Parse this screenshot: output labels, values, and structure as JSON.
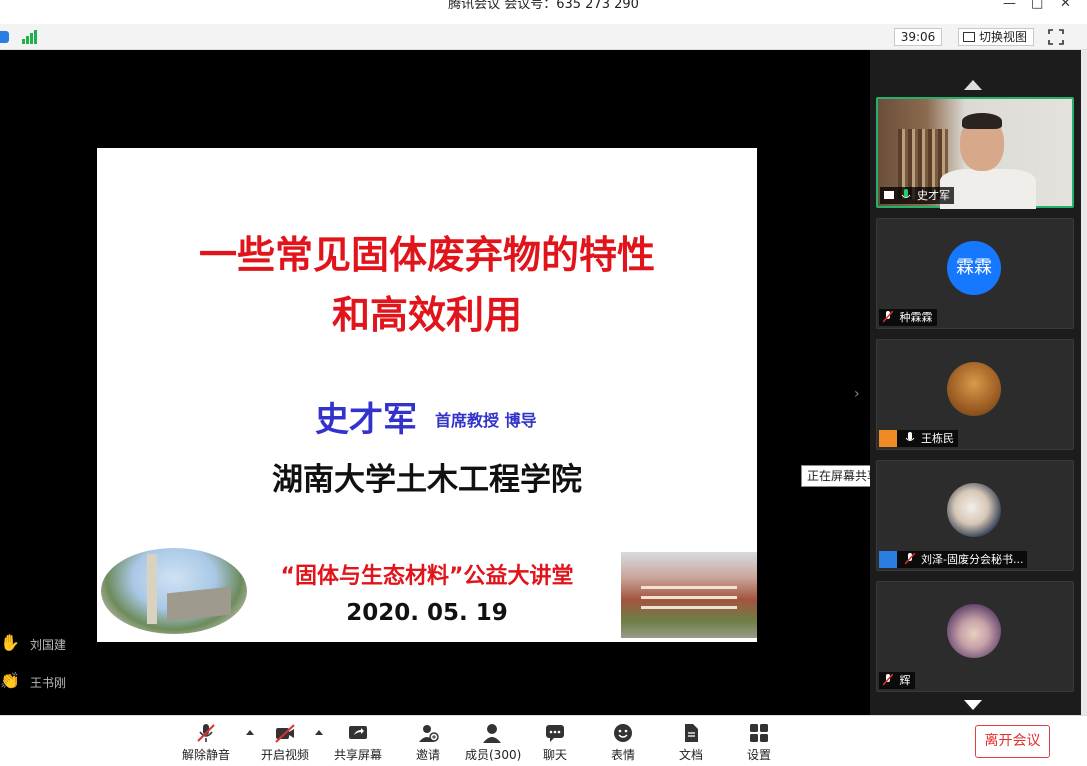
{
  "window": {
    "title": "腾讯会议  会议号：635 273 290"
  },
  "toolbar": {
    "timer": "39:06",
    "switch_view": "切换视图"
  },
  "slide": {
    "title_line1": "一些常见固体废弃物的特性",
    "title_line2": "和高效利用",
    "author": "史才军",
    "role": "首席教授  博导",
    "institution": "湖南大学土木工程学院",
    "lecture": "“固体与生态材料”公益大讲堂",
    "date": "2020. 05. 19"
  },
  "tooltip": "正在屏幕共享",
  "raised_hands": [
    {
      "name": "刘国建"
    },
    {
      "name": "王书刚"
    }
  ],
  "participants": [
    {
      "name": "史才军",
      "avatar": "video"
    },
    {
      "name": "种霖霖",
      "avatar_text": "霖霖"
    },
    {
      "name": "王栋民",
      "avatar": "photo"
    },
    {
      "name": "刘泽-固废分会秘书...",
      "avatar": "photo"
    },
    {
      "name": "辉",
      "avatar": "photo"
    }
  ],
  "bottom": {
    "unmute": "解除静音",
    "start_video": "开启视频",
    "share_screen": "共享屏幕",
    "invite": "邀请",
    "members": "成员(300)",
    "chat": "聊天",
    "emoji": "表情",
    "docs": "文档",
    "settings": "设置",
    "leave": "离开会议"
  },
  "colors": {
    "accent_green": "#25b06e",
    "brand_blue": "#1677ff",
    "slide_red": "#e0141a",
    "slide_blue": "#3333cc",
    "leave_red": "#e03030"
  }
}
